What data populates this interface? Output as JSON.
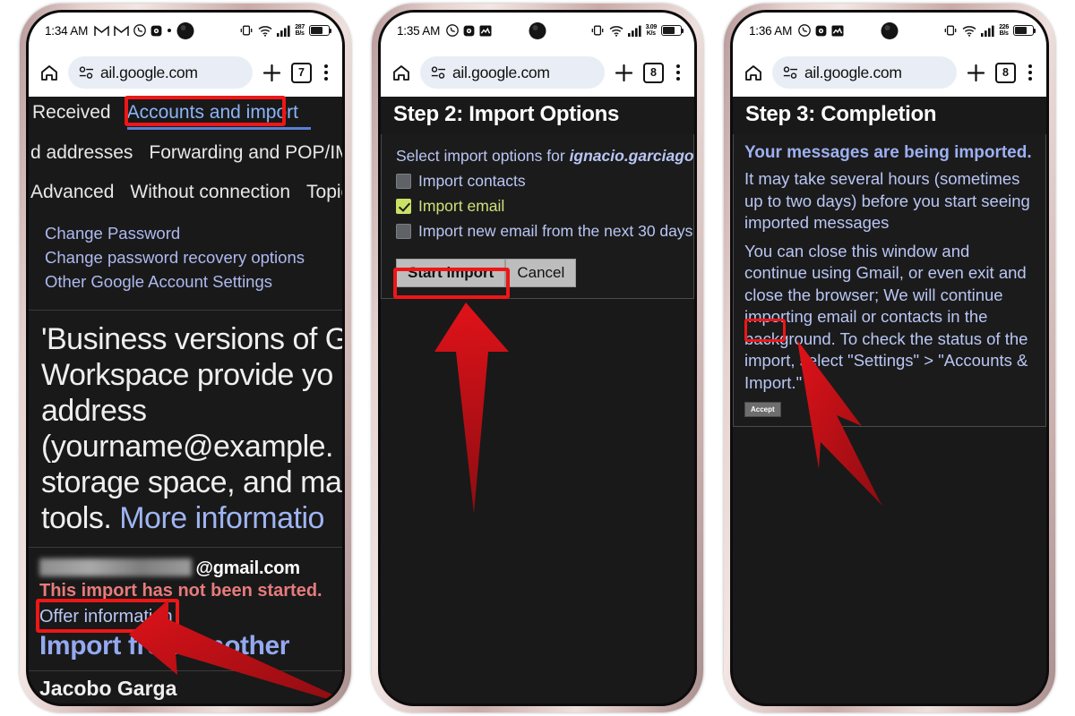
{
  "screens": [
    {
      "id": "screen-1",
      "status": {
        "time": "1:34 AM",
        "net_speed_value": "287",
        "net_speed_unit": "B/s",
        "icons": [
          "gmail-icon",
          "gmail-icon",
          "whatsapp-icon",
          "app-icon",
          "dot-icon"
        ],
        "right_icons": [
          "vibrate-icon",
          "wifi-icon",
          "signal-icon",
          "battery-icon"
        ]
      },
      "browser": {
        "home_icon": "home-icon",
        "site_settings_icon": "site-settings-icon",
        "url": "ail.google.com",
        "new_tab_icon": "plus-icon",
        "tab_count": "7",
        "menu_icon": "kebab-menu-icon"
      },
      "tabs": {
        "left": "Received",
        "active": "Accounts and import"
      },
      "subtabs": {
        "left": "d addresses",
        "right": "Forwarding and POP/IMA"
      },
      "subtabs2": {
        "a": "Advanced",
        "b": "Without connection",
        "c": "Topic"
      },
      "links": [
        "Change Password",
        "Change password recovery options",
        "Other Google Account Settings"
      ],
      "paragraph_lines": [
        "'Business versions of G",
        "Workspace provide yo",
        "address",
        "(yourname@example.",
        "storage space, and ma",
        "tools. "
      ],
      "paragraph_link": "More informatio",
      "account": {
        "masked_name": "",
        "domain": "@gmail.com",
        "warning": "This import has not been started.",
        "offer_link": "Offer information",
        "import_heading": "Import from another",
        "footer_name": "Jacobo Garga"
      }
    },
    {
      "id": "screen-2",
      "status": {
        "time": "1:35 AM",
        "net_speed_value": "3.09",
        "net_speed_unit": "K/s",
        "icons": [
          "whatsapp-icon",
          "app-icon",
          "chart-app-icon"
        ],
        "right_icons": [
          "vibrate-icon",
          "wifi-icon",
          "signal-icon",
          "battery-icon"
        ]
      },
      "browser": {
        "url": "ail.google.com",
        "tab_count": "8"
      },
      "step_title": "Step 2: Import Options",
      "dialog": {
        "lead_prefix": "Select import options for ",
        "lead_account": "ignacio.garciagonz",
        "options": [
          {
            "label": "Import contacts",
            "checked": false
          },
          {
            "label": "Import email",
            "checked": true
          },
          {
            "label": "Import new email from the next 30 days",
            "checked": false
          }
        ],
        "primary_button": "Start import",
        "secondary_button": "Cancel"
      }
    },
    {
      "id": "screen-3",
      "status": {
        "time": "1:36 AM",
        "net_speed_value": "226",
        "net_speed_unit": "B/s",
        "icons": [
          "whatsapp-icon",
          "app-icon",
          "chart-app-icon"
        ],
        "right_icons": [
          "vibrate-icon",
          "wifi-icon",
          "signal-icon",
          "battery-icon"
        ]
      },
      "browser": {
        "url": "ail.google.com",
        "tab_count": "8"
      },
      "step_title": "Step 3: Completion",
      "dialog": {
        "heading": "Your messages are being imported.",
        "paragraph1": "It may take several hours (sometimes up to two days) before you start seeing imported messages",
        "paragraph2": "You can close this window and continue using Gmail, or even exit and close the browser; We will continue importing email or contacts in the background. To check the status of the import, select \"Settings\" > \"Accounts & Import.\"",
        "accept_button": "Accept"
      }
    }
  ],
  "annotations": {
    "highlight_color": "#ee1616",
    "arrow_color": "#c2131a",
    "boxes": [
      {
        "name": "accounts-and-import-highlight"
      },
      {
        "name": "offer-information-highlight"
      },
      {
        "name": "start-import-highlight"
      },
      {
        "name": "accept-highlight"
      }
    ],
    "arrows": [
      {
        "name": "arrow-to-offer-information",
        "direction": "up-left"
      },
      {
        "name": "arrow-to-start-import",
        "direction": "up"
      },
      {
        "name": "arrow-to-accept",
        "direction": "up-left"
      }
    ]
  }
}
